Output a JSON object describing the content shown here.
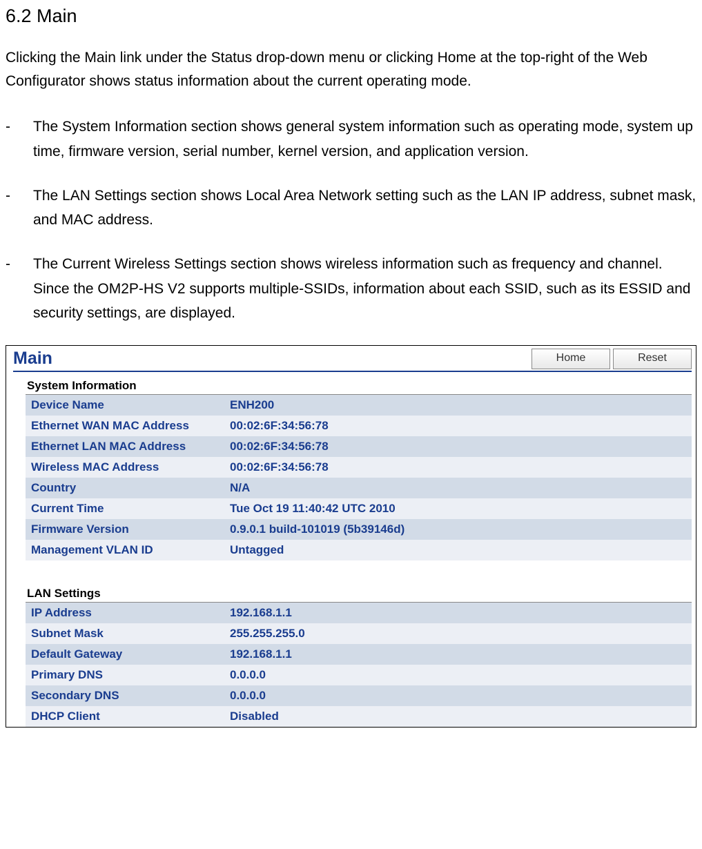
{
  "heading": "6.2 Main",
  "intro": "Clicking the Main link under the Status drop-down menu or clicking Home at the top-right of the Web Configurator shows status information about the current operating mode.",
  "bullets": [
    "The System Information section shows general system information such as operating mode, system up time, firmware version, serial number, kernel version, and application version.",
    "The LAN Settings section shows Local Area Network setting such as the LAN IP address, subnet mask, and MAC address.",
    "The Current Wireless Settings section shows wireless information such as frequency and channel. Since the OM2P-HS V2 supports multiple-SSIDs, information about each SSID, such as its ESSID and security settings, are displayed."
  ],
  "panel": {
    "title": "Main",
    "buttons": {
      "home": "Home",
      "reset": "Reset"
    },
    "system_info": {
      "label": "System Information",
      "rows": [
        {
          "label": "Device Name",
          "value": "ENH200"
        },
        {
          "label": "Ethernet WAN MAC Address",
          "value": "00:02:6F:34:56:78"
        },
        {
          "label": "Ethernet LAN MAC Address",
          "value": "00:02:6F:34:56:78"
        },
        {
          "label": "Wireless MAC Address",
          "value": "00:02:6F:34:56:78"
        },
        {
          "label": "Country",
          "value": "N/A"
        },
        {
          "label": "Current Time",
          "value": "Tue Oct 19 11:40:42 UTC 2010"
        },
        {
          "label": "Firmware Version",
          "value": "0.9.0.1 build-101019 (5b39146d)"
        },
        {
          "label": "Management VLAN ID",
          "value": "Untagged"
        }
      ]
    },
    "lan_settings": {
      "label": "LAN Settings",
      "rows": [
        {
          "label": "IP Address",
          "value": "192.168.1.1"
        },
        {
          "label": "Subnet Mask",
          "value": "255.255.255.0"
        },
        {
          "label": "Default Gateway",
          "value": "192.168.1.1"
        },
        {
          "label": "Primary DNS",
          "value": "0.0.0.0"
        },
        {
          "label": "Secondary DNS",
          "value": "0.0.0.0"
        },
        {
          "label": "DHCP Client",
          "value": "Disabled"
        }
      ]
    }
  }
}
